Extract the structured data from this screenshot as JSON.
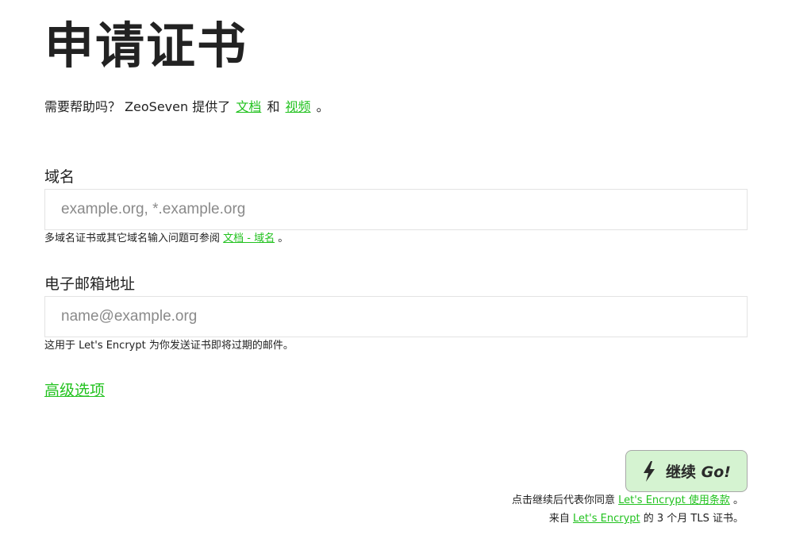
{
  "title": "申请证书",
  "help": {
    "prefix": "需要帮助吗？ ZeoSeven 提供了",
    "docs_link": "文档",
    "and": "和",
    "video_link": "视频",
    "suffix": "。"
  },
  "domain_field": {
    "label": "域名",
    "placeholder": "example.org, *.example.org",
    "value": "",
    "hint_prefix": "多域名证书或其它域名输入问题可参阅",
    "hint_link": "文档 - 域名",
    "hint_suffix": "。"
  },
  "email_field": {
    "label": "电子邮箱地址",
    "placeholder": "name@example.org",
    "value": "",
    "hint": "这用于 Let's Encrypt 为你发送证书即将过期的邮件。"
  },
  "advanced_link": "高级选项",
  "continue_button": {
    "label": "继续",
    "label_en": "Go!",
    "icon": "lightning-bolt-icon"
  },
  "agreement": {
    "line1_prefix": "点击继续后代表你同意",
    "line1_link": "Let's Encrypt 使用条款",
    "line1_suffix": "。",
    "line2_prefix": "来自",
    "line2_link": "Let's Encrypt",
    "line2_suffix": "的 3 个月 TLS 证书。"
  },
  "colors": {
    "link": "#22c21f",
    "button_bg": "#d5f3d1",
    "text": "#222222"
  }
}
